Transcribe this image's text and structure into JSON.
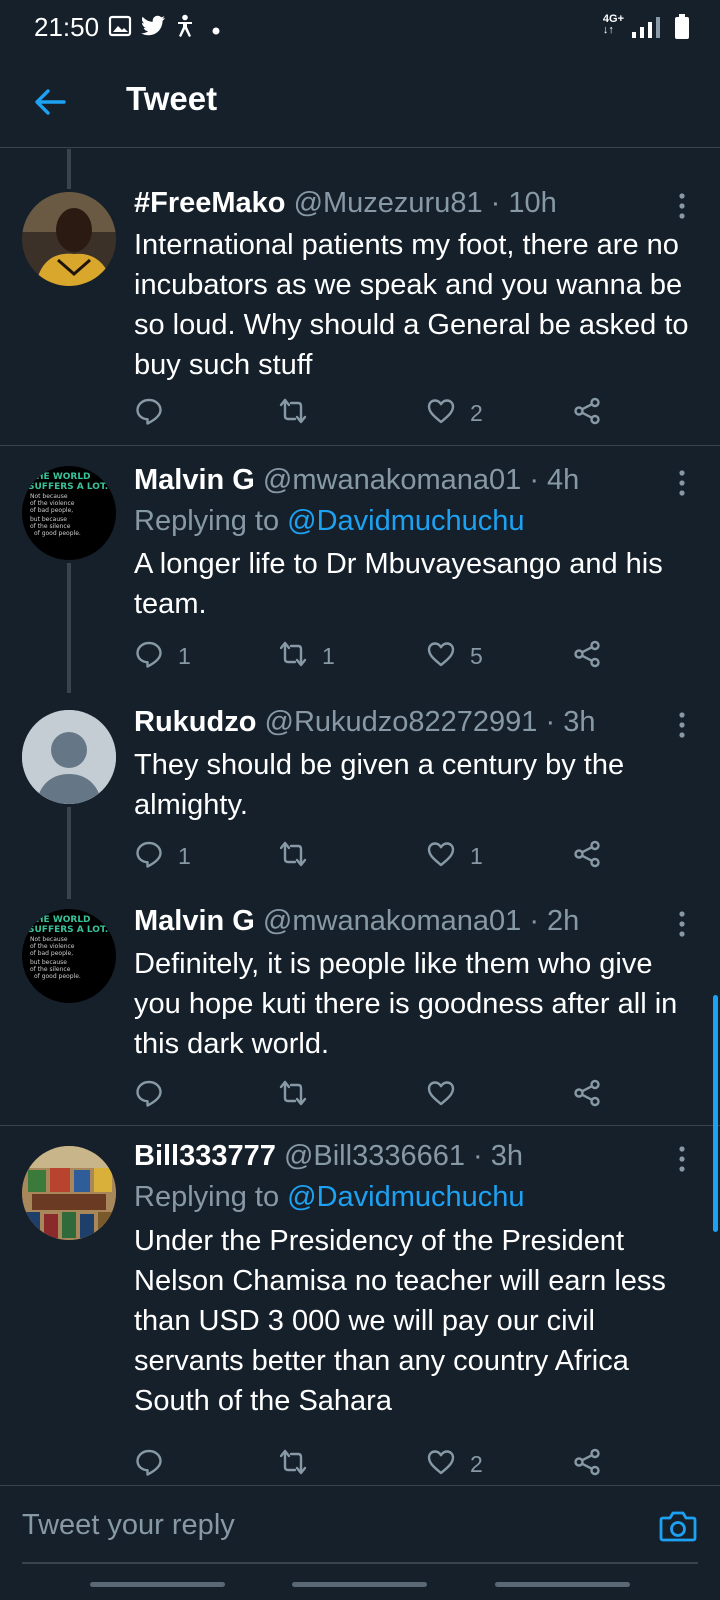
{
  "status_bar": {
    "time": "21:50",
    "network": "4G+",
    "left_icons": [
      "image-icon",
      "twitter-icon",
      "accessibility-icon",
      "dot-icon"
    ],
    "right_icons": [
      "network-4g-icon",
      "signal-icon",
      "battery-icon"
    ]
  },
  "header": {
    "title": "Tweet",
    "back_icon": "arrow-left-icon"
  },
  "tweets": [
    {
      "name": "#FreeMako",
      "handle": "@Muzezuru81 · 10h",
      "replying_label": "",
      "replying_to": "",
      "text": "International patients my foot, there are no incubators as we speak and you wanna be so loud. Why should a General be asked to buy such stuff",
      "reply_count": "",
      "retweet_count": "",
      "like_count": "2"
    },
    {
      "name": "Malvin G",
      "handle": "@mwanakomana01 · 4h",
      "replying_label": "Replying to ",
      "replying_to": "@Davidmuchuchu",
      "text": "A longer life to Dr Mbuvayesango and his team.",
      "reply_count": "1",
      "retweet_count": "1",
      "like_count": "5",
      "avatar_text": {
        "line1": "HE WORLD",
        "line2": "SUFFERS A LOT.",
        "line3": "Not because",
        "line4": "of the violence",
        "line5": "of bad people,",
        "line6": "but because",
        "line7": "of the silence",
        "line8": "of good people."
      }
    },
    {
      "name": "Rukudzo",
      "handle": "@Rukudzo82272991 · 3h",
      "replying_label": "",
      "replying_to": "",
      "text": "They should be given a century by the almighty.",
      "reply_count": "1",
      "retweet_count": "",
      "like_count": "1"
    },
    {
      "name": "Malvin G",
      "handle": "@mwanakomana01 · 2h",
      "replying_label": "",
      "replying_to": "",
      "text": "Definitely, it is people like them who give you hope kuti there is goodness after all in this dark world.",
      "reply_count": "",
      "retweet_count": "",
      "like_count": ""
    },
    {
      "name": "Bill333777",
      "handle": "@Bill3336661 · 3h",
      "replying_label": "Replying to ",
      "replying_to": "@Davidmuchuchu",
      "text": "Under the Presidency of the President Nelson Chamisa no teacher will earn less than USD 3 000 we will pay our civil servants better than any country Africa South of the Sahara",
      "reply_count": "",
      "retweet_count": "",
      "like_count": "2"
    }
  ],
  "reply_box": {
    "placeholder": "Tweet your reply",
    "camera_icon": "camera-icon"
  },
  "colors": {
    "background": "#15202b",
    "accent": "#1da1f2",
    "secondary_text": "#8899a6",
    "divider": "#38444d"
  }
}
